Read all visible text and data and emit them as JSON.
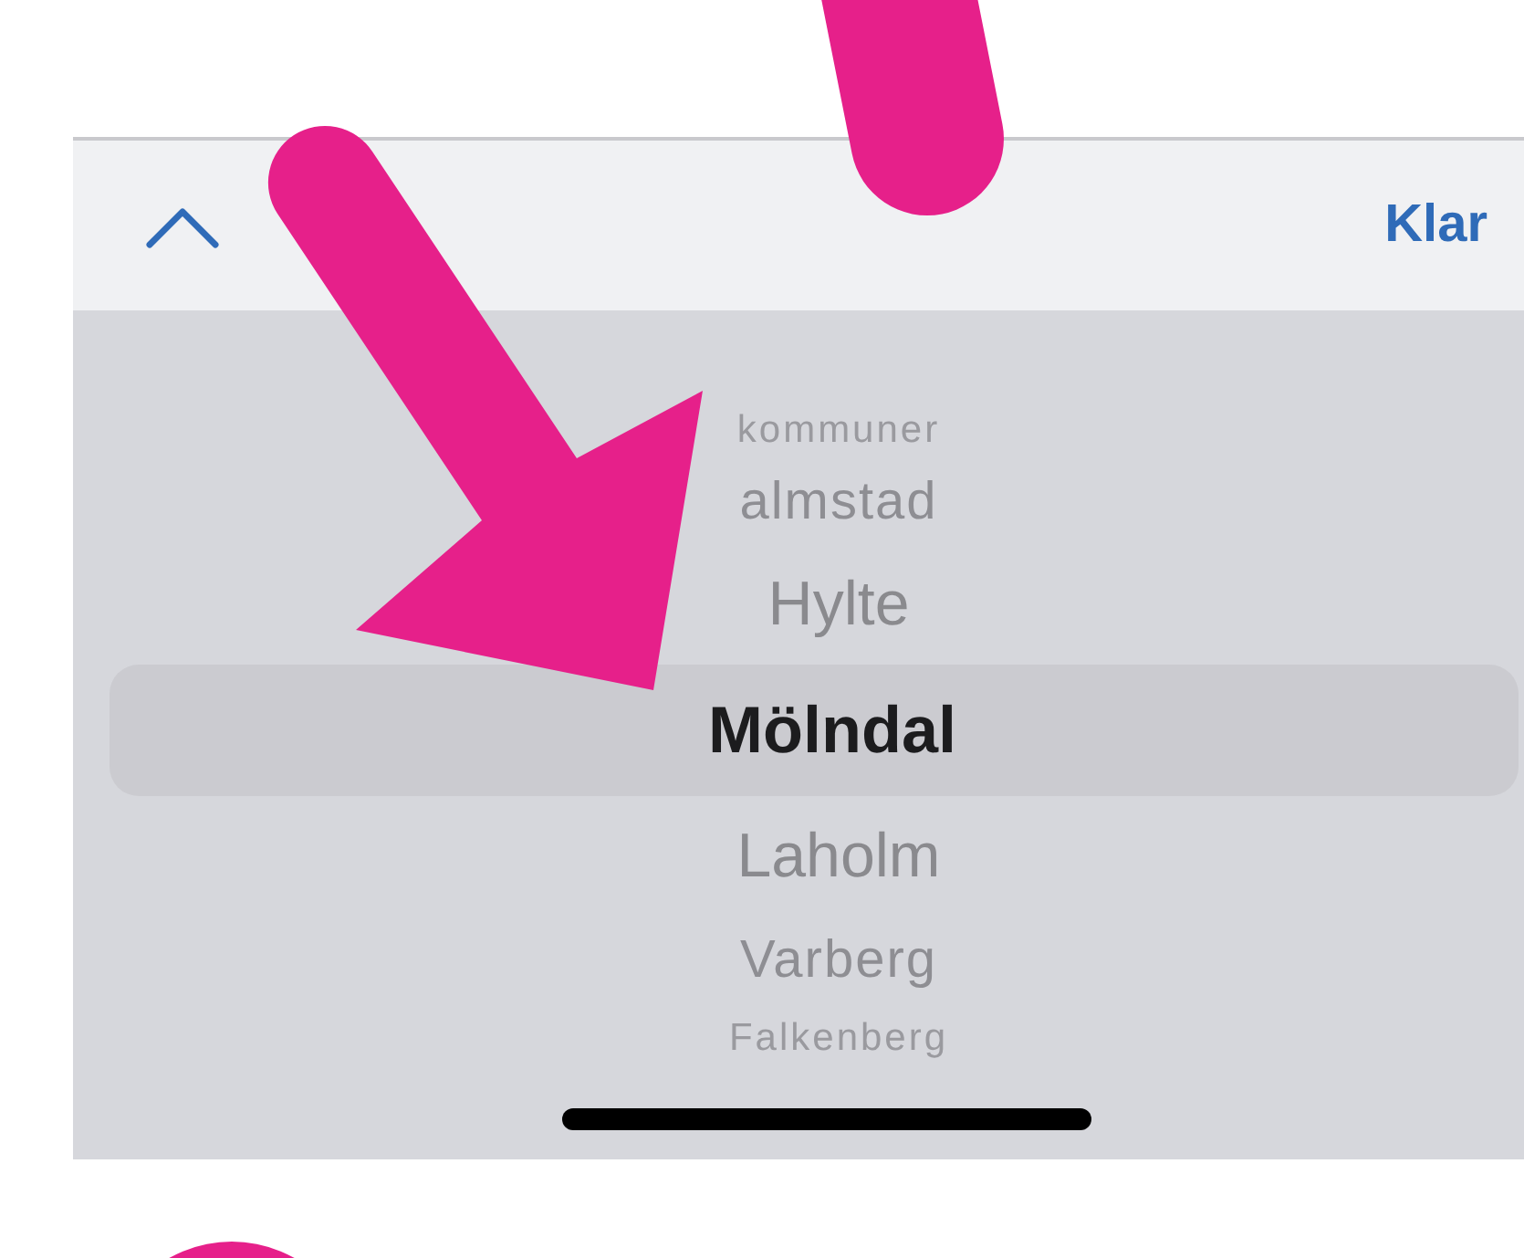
{
  "toolbar": {
    "done_label": "Klar"
  },
  "picker": {
    "items": [
      {
        "label": "kommuner",
        "selected": false
      },
      {
        "label": "almstad",
        "selected": false
      },
      {
        "label": "Hylte",
        "selected": false
      },
      {
        "label": "Mölndal",
        "selected": true
      },
      {
        "label": "Laholm",
        "selected": false
      },
      {
        "label": "Varberg",
        "selected": false
      },
      {
        "label": "Falkenberg",
        "selected": false
      }
    ]
  }
}
